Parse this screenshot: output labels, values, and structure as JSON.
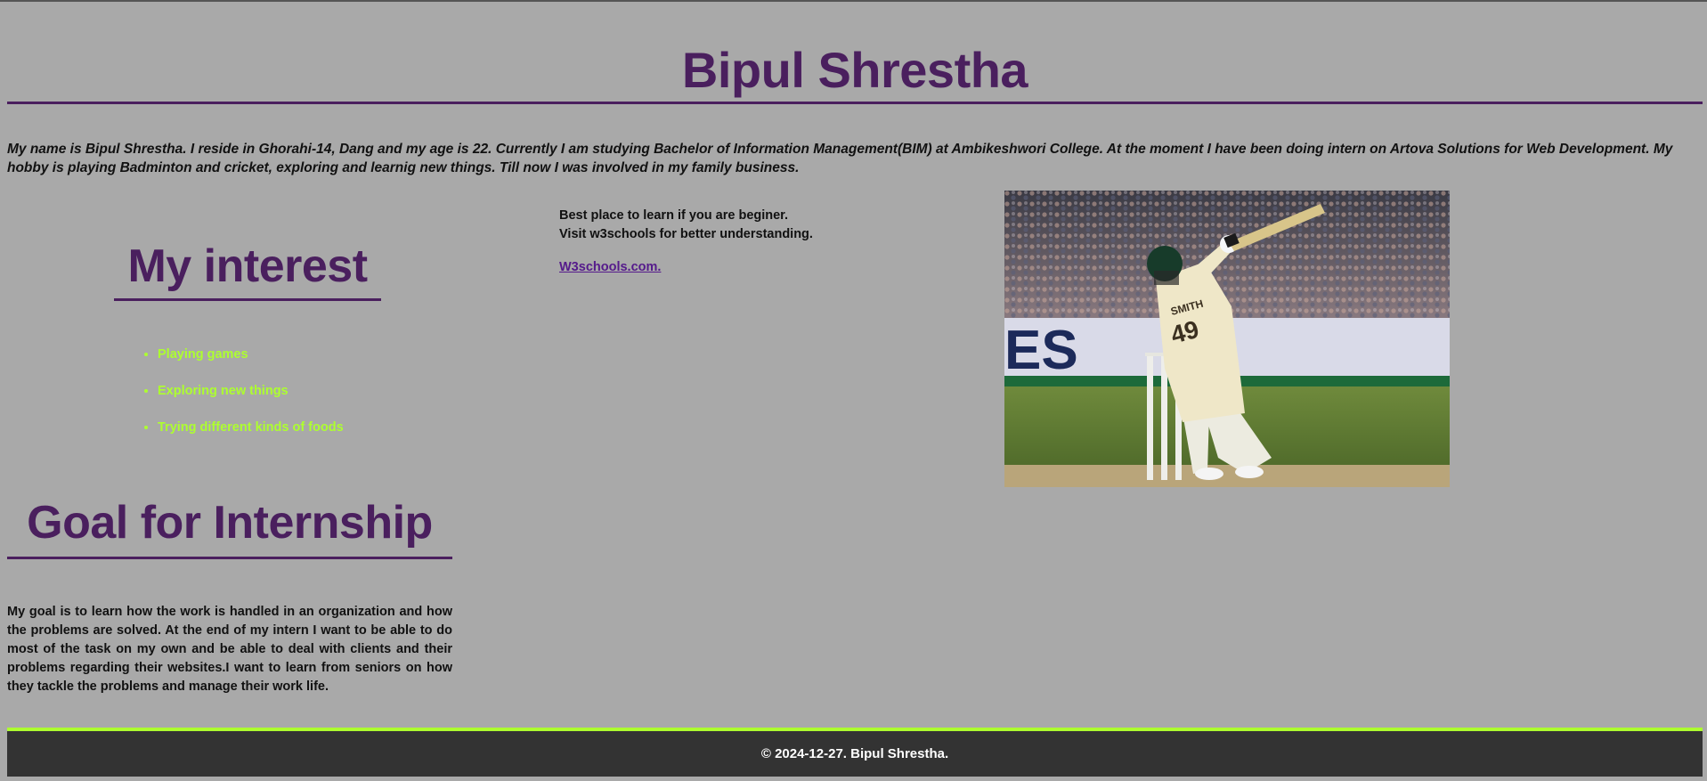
{
  "header": {
    "title": "Bipul Shrestha"
  },
  "intro": {
    "text": "My name is Bipul Shrestha. I reside in Ghorahi-14, Dang and my age is 22. Currently I am studying Bachelor of Information Management(BIM) at Ambikeshwori College. At the moment I have been doing intern on Artova Solutions for Web Development. My hobby is playing Badminton and cricket, exploring and learnig new things. Till now I was involved in my family business."
  },
  "interest": {
    "title": "My interest",
    "items": [
      "Playing games",
      "Exploring new things",
      "Trying different kinds of foods"
    ]
  },
  "learn": {
    "line1": "Best place to learn if you are beginer.",
    "line2": "Visit w3schools for better understanding.",
    "link_label": "W3schools.com."
  },
  "goal": {
    "title": "Goal for Internship",
    "text": "My goal is to learn how the work is handled in an organization and how the problems are solved. At the end of my intern I want to be able to do most of the task on my own and be able to deal with clients and their problems regarding their websites.I want to learn from seniors on how they tackle the problems and manage their work life."
  },
  "photo": {
    "icon": "cricket-batsman-photo",
    "shirt_name": "SMITH",
    "shirt_number": "49",
    "banner_text": "ES"
  },
  "footer": {
    "copyright": "© 2024-12-27. Bipul Shrestha."
  },
  "colors": {
    "background": "#a9a9a9",
    "heading": "#4a1f5e",
    "list_text": "#adff2f",
    "footer_bg": "#333333",
    "footer_border": "#adff2f",
    "link": "#551a8b"
  }
}
